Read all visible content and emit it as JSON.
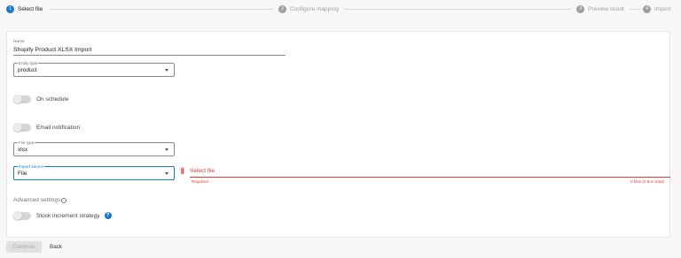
{
  "stepper": {
    "steps": [
      {
        "num": "1",
        "label": "Select file"
      },
      {
        "num": "2",
        "label": "Configure mapping"
      },
      {
        "num": "3",
        "label": "Preview result"
      },
      {
        "num": "4",
        "label": "Import"
      }
    ],
    "active_step": 1
  },
  "form": {
    "name": {
      "label": "Name",
      "value": "Shopify Product XLSX Import"
    },
    "entity_type": {
      "label": "Entity type",
      "value": "product"
    },
    "on_schedule": {
      "label": "On schedule",
      "enabled": false
    },
    "email_notification": {
      "label": "Email notification",
      "enabled": false
    },
    "file_type": {
      "label": "File type",
      "value": "xlsx"
    },
    "import_source": {
      "label": "Import source",
      "value": "File"
    },
    "select_file": {
      "label": "Select file",
      "required_text": "Required",
      "files_info": "0 files (0 B in total)"
    },
    "advanced_settings": {
      "label": "Advanced settings",
      "toggle_glyph": "−"
    },
    "stock_increment": {
      "label": "Stock increment strategy",
      "enabled": false,
      "help": "?"
    }
  },
  "footer": {
    "continue_label": "Continue",
    "back_label": "Back"
  },
  "colors": {
    "accent": "#1976d2",
    "error": "#e53935",
    "inactive_step": "#9e9e9e"
  },
  "icons": [
    "paperclip-icon",
    "help-icon",
    "chevron-down-icon",
    "collapse-circle-icon"
  ]
}
